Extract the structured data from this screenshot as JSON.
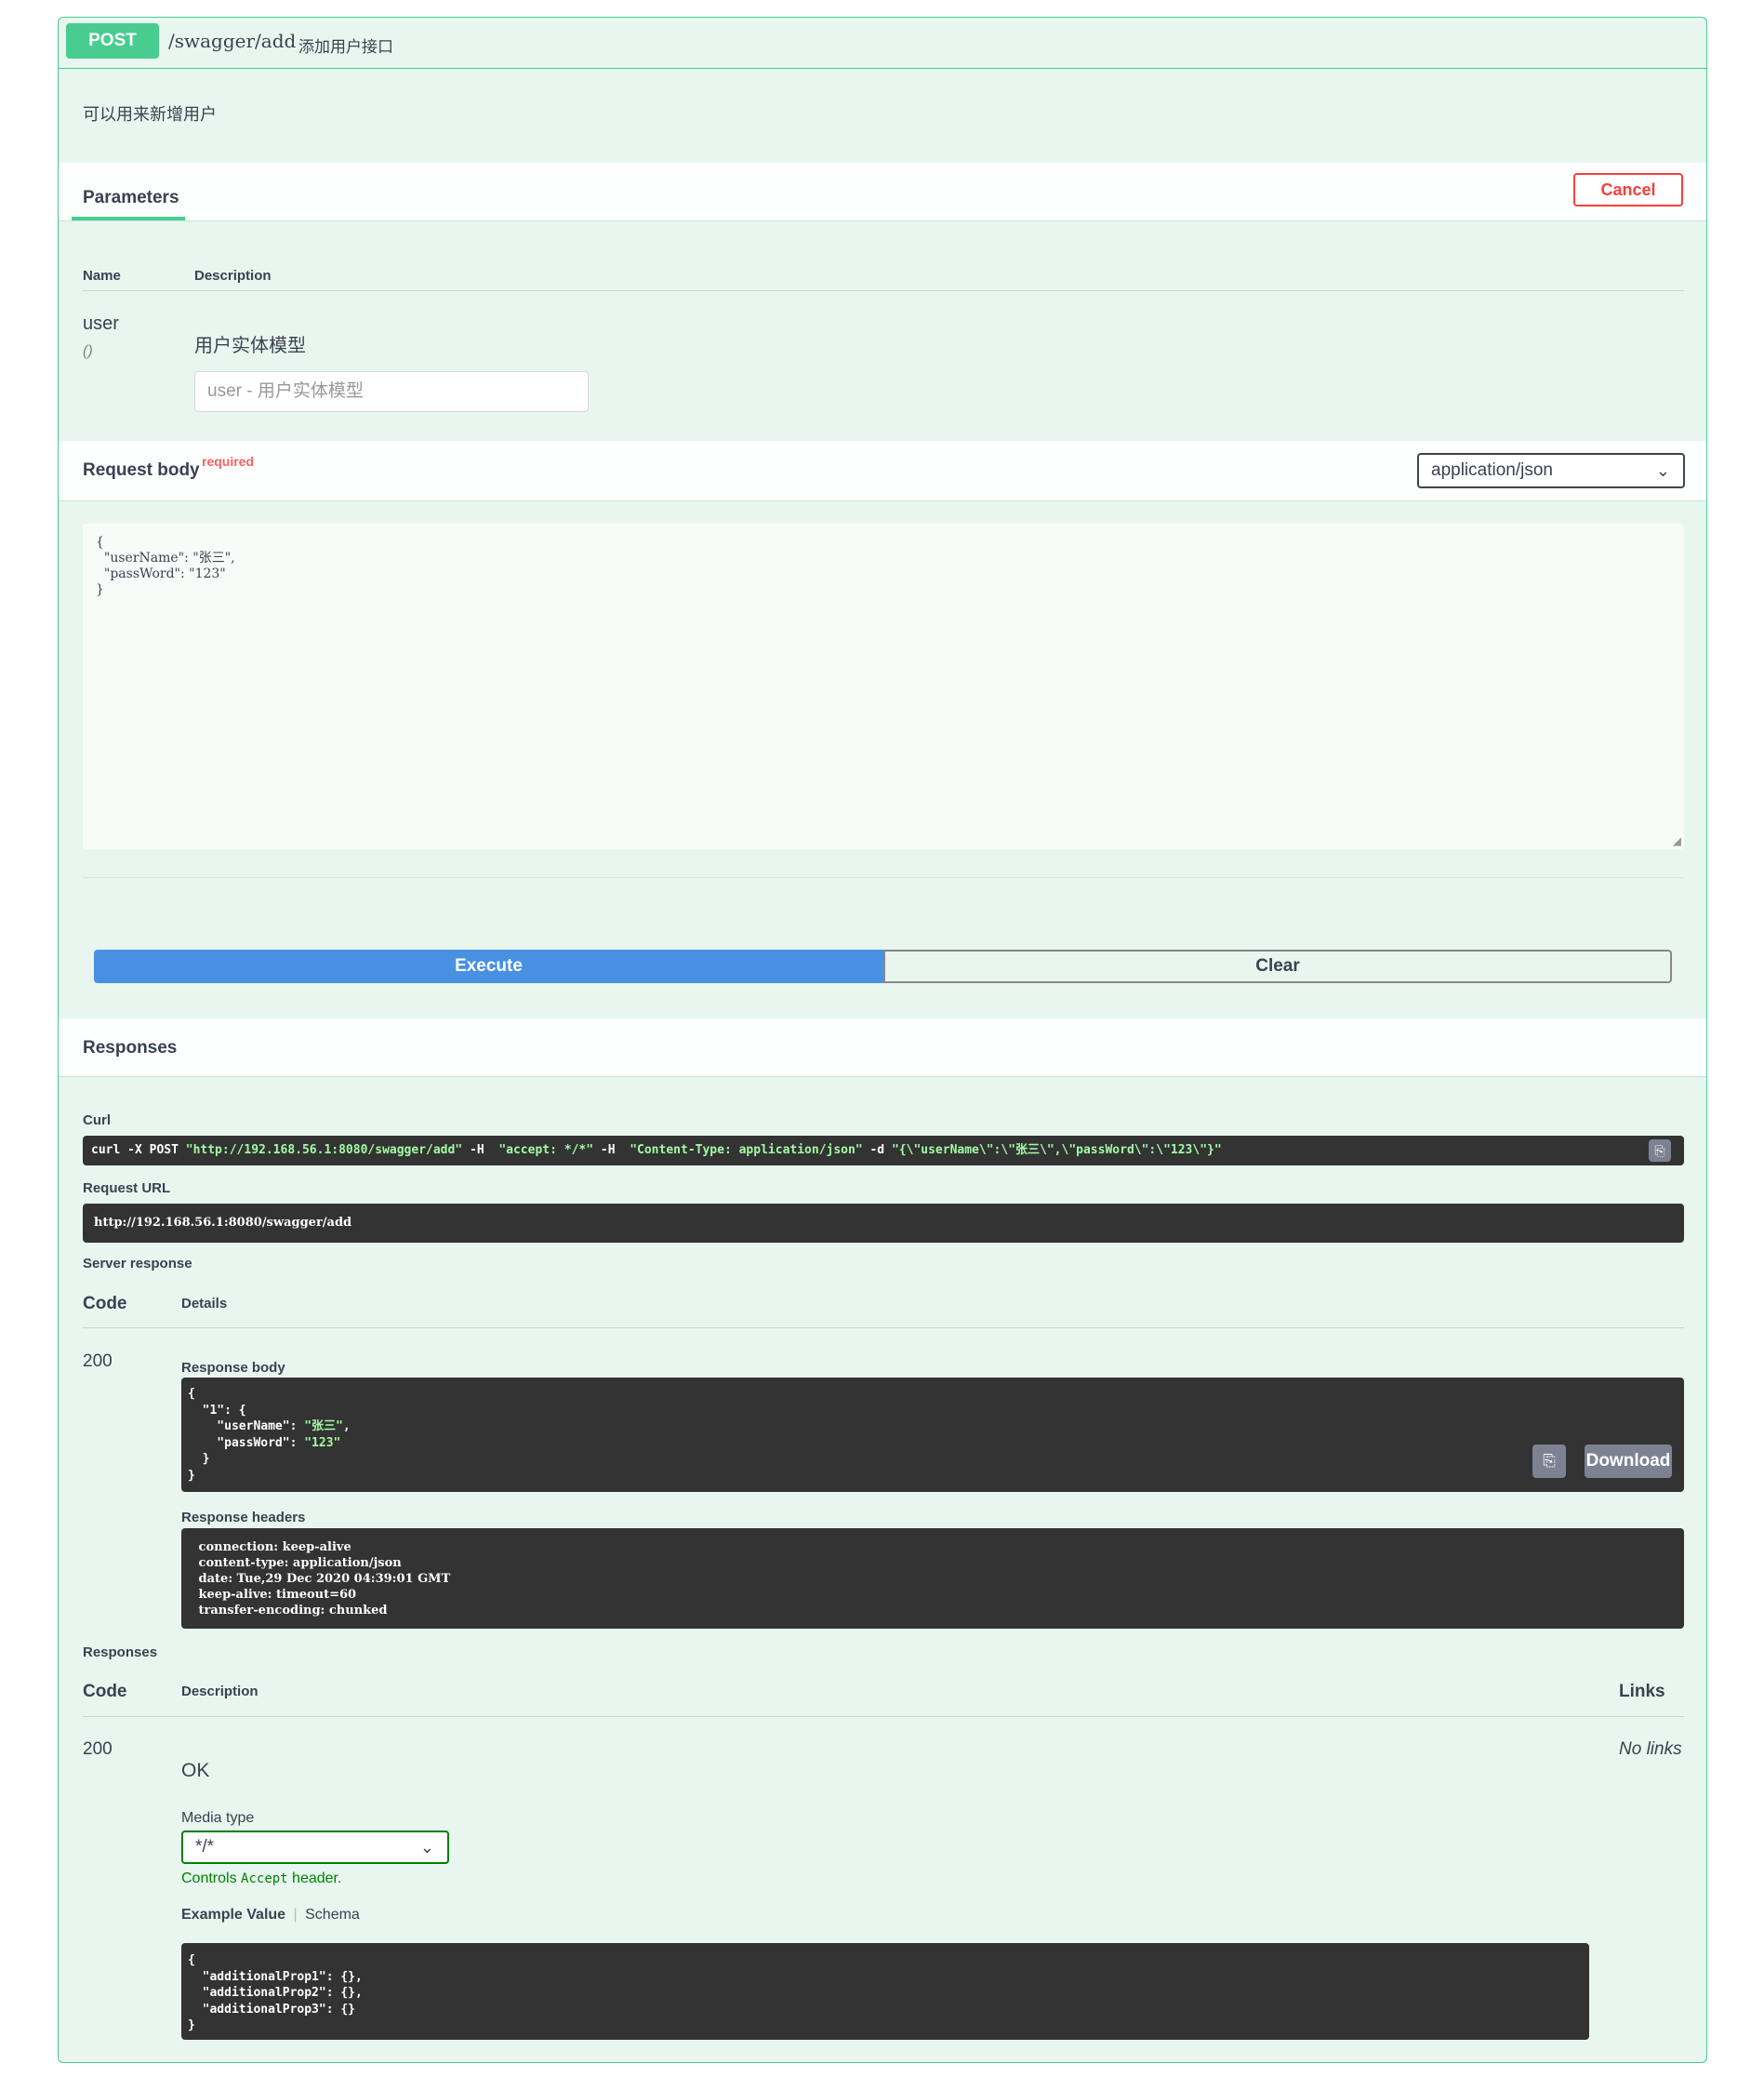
{
  "operation": {
    "method": "POST",
    "path": "/swagger/add",
    "summary": "添加用户接口",
    "description": "可以用来新增用户"
  },
  "parameters": {
    "tab_label": "Parameters",
    "cancel_label": "Cancel",
    "col_name": "Name",
    "col_description": "Description",
    "param_name": "user",
    "param_in": "()",
    "param_description": "用户实体模型",
    "input_placeholder": "user - 用户实体模型"
  },
  "request_body": {
    "title": "Request body",
    "required_label": "required",
    "content_type": "application/json",
    "lines": [
      "{",
      "  \"userName\": \"张三\",",
      "  \"passWord\": \"123\"",
      "}"
    ]
  },
  "actions": {
    "execute_label": "Execute",
    "clear_label": "Clear"
  },
  "responses_live": {
    "title": "Responses",
    "curl_label": "Curl",
    "curl": {
      "cmd": "curl -X POST ",
      "url": "\"http://192.168.56.1:8080/swagger/add\"",
      "h1": " -H  ",
      "accept": "\"accept: */*\"",
      "h2": " -H  ",
      "ctype": "\"Content-Type: application/json\"",
      "d": " -d ",
      "body": "\"{\\\"userName\\\":\\\"张三\\\",\\\"passWord\\\":\\\"123\\\"}\""
    },
    "request_url_label": "Request URL",
    "request_url": "http://192.168.56.1:8080/swagger/add",
    "server_response_label": "Server response",
    "col_code": "Code",
    "col_details": "Details",
    "code": "200",
    "response_body_label": "Response body",
    "response_body": {
      "l1": "{",
      "l2": "  \"1\": {",
      "l3_key": "    \"userName\": ",
      "l3_val": "\"张三\"",
      "l3_end": ",",
      "l4_key": "    \"passWord\": ",
      "l4_val": "\"123\"",
      "l5": "  }",
      "l6": "}"
    },
    "download_label": "Download",
    "response_headers_label": "Response headers",
    "headers": [
      " connection: keep-alive",
      " content-type: application/json",
      " date: Tue,29 Dec 2020 04:39:01 GMT",
      " keep-alive: timeout=60",
      " transfer-encoding: chunked"
    ]
  },
  "responses_doc": {
    "title": "Responses",
    "col_code": "Code",
    "col_description": "Description",
    "col_links": "Links",
    "code": "200",
    "description": "OK",
    "links": "No links",
    "media_type_label": "Media type",
    "media_type": "*/*",
    "controls_prefix": "Controls ",
    "controls_code": "Accept",
    "controls_suffix": " header.",
    "example_tab": "Example Value",
    "schema_tab": "Schema",
    "example_lines": [
      "{",
      "  \"additionalProp1\": {},",
      "  \"additionalProp2\": {},",
      "  \"additionalProp3\": {}",
      "}"
    ]
  },
  "colors": {
    "post_green": "#49cc90",
    "execute_blue": "#4990e2",
    "cancel_red": "#f93e3e",
    "code_dark": "#333333"
  },
  "icons": {
    "chevron": "chevron-down-icon",
    "copy": "copy-icon"
  }
}
